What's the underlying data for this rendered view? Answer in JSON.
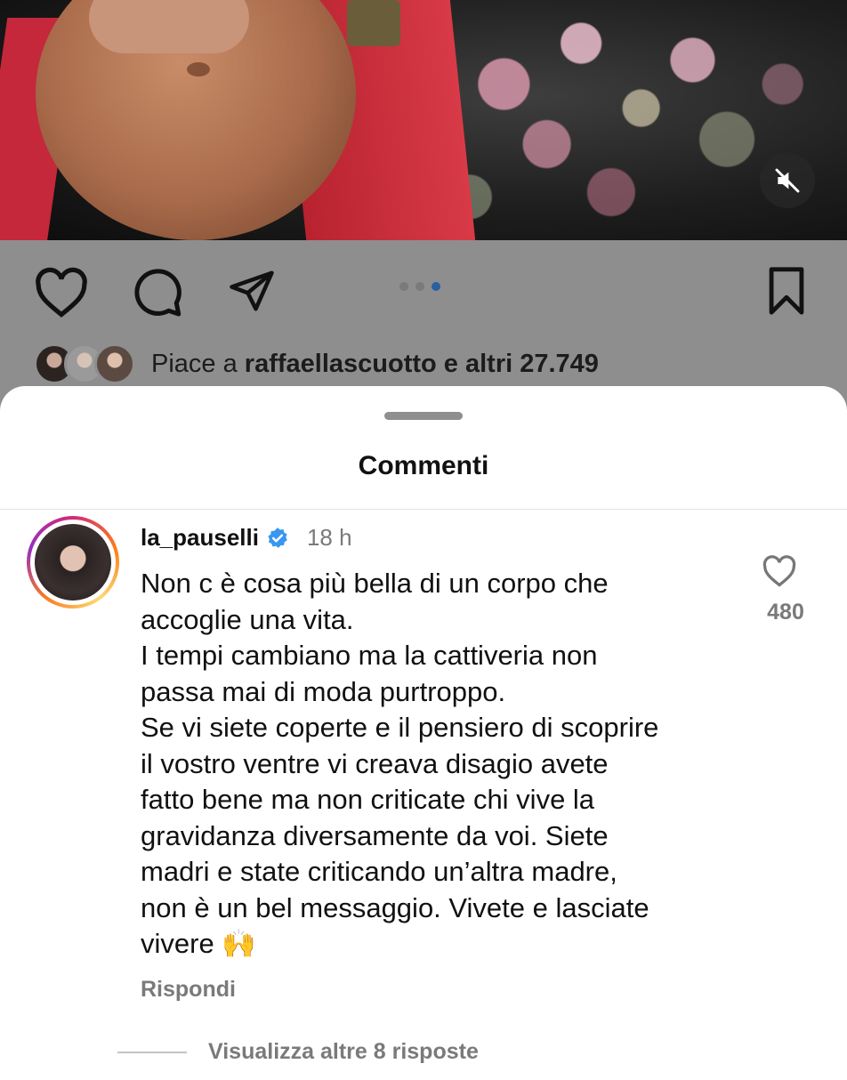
{
  "media": {
    "mute_icon": "speaker-muted-icon"
  },
  "actions": {
    "like_icon": "heart-icon",
    "comment_icon": "comment-icon",
    "share_icon": "send-icon",
    "save_icon": "bookmark-icon",
    "carousel": {
      "count": 3,
      "active_index": 2
    }
  },
  "likes": {
    "prefix": "Piace a ",
    "user": "raffaellascuotto",
    "suffix": " e altri 27.749"
  },
  "sheet": {
    "title": "Commenti"
  },
  "comment": {
    "username": "la_pauselli",
    "verified": true,
    "time": "18 h",
    "text": "Non c è cosa più bella di un corpo che\naccoglie una vita.\nI tempi cambiano ma la cattiveria non\npassa mai di moda purtroppo.\nSe vi siete coperte e il pensiero di scoprire\nil vostro ventre vi creava disagio avete\nfatto bene ma non criticate chi vive la\ngravidanza diversamente da voi. Siete\nmadri e state criticando un’altra madre,\nnon è un bel messaggio. Vivete e lasciate\nvivere 🙌",
    "reply_label": "Rispondi",
    "like_count": "480",
    "view_more": "Visualizza altre 8 risposte"
  },
  "colors": {
    "accent_blue": "#3897f0",
    "overlay_gray": "#8e8e8e",
    "muted_text": "#7a7a7a"
  }
}
